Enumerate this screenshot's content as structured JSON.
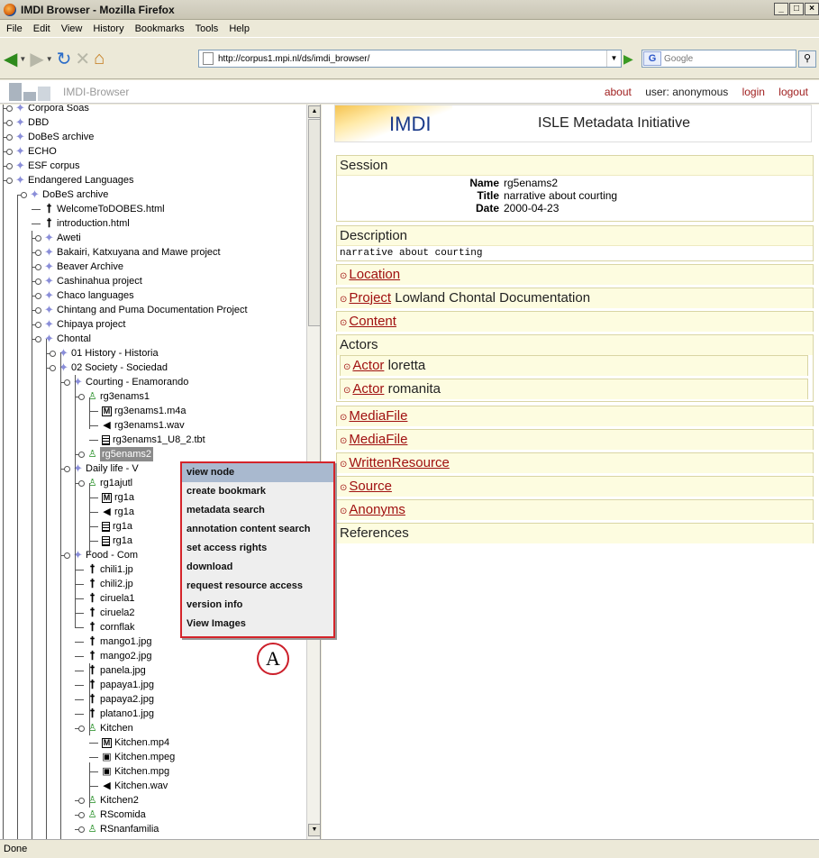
{
  "window": {
    "title": "IMDI Browser - Mozilla Firefox"
  },
  "menu": [
    "File",
    "Edit",
    "View",
    "History",
    "Bookmarks",
    "Tools",
    "Help"
  ],
  "nav": {
    "url": "http://corpus1.mpi.nl/ds/imdi_browser/",
    "search_placeholder": "Google",
    "search_engine": "G"
  },
  "app": {
    "name": "IMDI-Browser",
    "links": {
      "about": "about",
      "user": "user: anonymous",
      "login": "login",
      "logout": "logout"
    }
  },
  "tree": [
    {
      "label": "Corpora Soas",
      "icon": "dia"
    },
    {
      "label": "DBD",
      "icon": "dia"
    },
    {
      "label": "DoBeS archive",
      "icon": "dia"
    },
    {
      "label": "ECHO",
      "icon": "dia"
    },
    {
      "label": "ESF corpus",
      "icon": "dia"
    },
    {
      "label": "Endangered Languages",
      "icon": "dia"
    },
    {
      "label": "DoBeS archive",
      "icon": "dia"
    },
    {
      "label": "WelcomeToDOBES.html",
      "icon": "doc"
    },
    {
      "label": "introduction.html",
      "icon": "doc"
    },
    {
      "label": "Aweti",
      "icon": "dia"
    },
    {
      "label": "Bakairi, Katxuyana and Mawe project",
      "icon": "dia"
    },
    {
      "label": "Beaver Archive",
      "icon": "dia"
    },
    {
      "label": "Cashinahua project",
      "icon": "dia"
    },
    {
      "label": "Chaco languages",
      "icon": "dia"
    },
    {
      "label": "Chintang and Puma Documentation Project",
      "icon": "dia"
    },
    {
      "label": "Chipaya project",
      "icon": "dia"
    },
    {
      "label": "Chontal",
      "icon": "dia"
    },
    {
      "label": "01 History - Historia",
      "icon": "dia"
    },
    {
      "label": "02 Society - Sociedad",
      "icon": "dia"
    },
    {
      "label": "Courting - Enamorando",
      "icon": "dia"
    },
    {
      "label": "rg3enams1",
      "icon": "bag"
    },
    {
      "label": "rg3enams1.m4a",
      "icon": "m"
    },
    {
      "label": "rg3enams1.wav",
      "icon": "wav"
    },
    {
      "label": "rg3enams1_U8_2.tbt",
      "icon": "txt"
    },
    {
      "label": "rg5enams2",
      "icon": "bag"
    },
    {
      "label": "Daily life - V",
      "icon": "dia"
    },
    {
      "label": "rg1ajutl",
      "icon": "bag"
    },
    {
      "label": "rg1a",
      "icon": "m"
    },
    {
      "label": "rg1a",
      "icon": "wav"
    },
    {
      "label": "rg1a",
      "icon": "txt"
    },
    {
      "label": "rg1a",
      "icon": "txt"
    },
    {
      "label": "Food - Com",
      "icon": "dia"
    },
    {
      "label": "chili1.jp",
      "icon": "doc"
    },
    {
      "label": "chili2.jp",
      "icon": "doc"
    },
    {
      "label": "ciruela1",
      "icon": "doc"
    },
    {
      "label": "ciruela2",
      "icon": "doc"
    },
    {
      "label": "cornflak",
      "icon": "doc"
    },
    {
      "label": "mango1.jpg",
      "icon": "doc"
    },
    {
      "label": "mango2.jpg",
      "icon": "doc"
    },
    {
      "label": "panela.jpg",
      "icon": "doc"
    },
    {
      "label": "papaya1.jpg",
      "icon": "doc"
    },
    {
      "label": "papaya2.jpg",
      "icon": "doc"
    },
    {
      "label": "platano1.jpg",
      "icon": "doc"
    },
    {
      "label": "Kitchen",
      "icon": "bag"
    },
    {
      "label": "Kitchen.mp4",
      "icon": "m"
    },
    {
      "label": "Kitchen.mpeg",
      "icon": "mov"
    },
    {
      "label": "Kitchen.mpg",
      "icon": "mov"
    },
    {
      "label": "Kitchen.wav",
      "icon": "wav"
    },
    {
      "label": "Kitchen2",
      "icon": "bag"
    },
    {
      "label": "RScomida",
      "icon": "bag"
    },
    {
      "label": "RSnanfamilia",
      "icon": "bag"
    }
  ],
  "context_menu": [
    "view node",
    "create bookmark",
    "metadata search",
    "annotation content search",
    "set access rights",
    "download",
    "request resource access",
    "version info",
    "View Images"
  ],
  "callout": "A",
  "imdi": {
    "logo": "IMDI",
    "title": "ISLE Metadata Initiative"
  },
  "session": {
    "heading": "Session",
    "name_label": "Name",
    "name": "rg5enams2",
    "title_label": "Title",
    "title": "narrative about courting",
    "date_label": "Date",
    "date": "2000-04-23"
  },
  "description": {
    "heading": "Description",
    "text": "narrative about courting"
  },
  "location": {
    "link": "Location"
  },
  "project": {
    "link": "Project",
    "value": "Lowland Chontal Documentation"
  },
  "content": {
    "link": "Content"
  },
  "actors": {
    "heading": "Actors",
    "items": [
      {
        "link": "Actor",
        "value": "loretta"
      },
      {
        "link": "Actor",
        "value": "romanita"
      }
    ]
  },
  "mediafiles": [
    "MediaFile",
    "MediaFile"
  ],
  "written": "WrittenResource",
  "source": "Source",
  "anonyms": "Anonyms",
  "references": "References",
  "status": "Done"
}
